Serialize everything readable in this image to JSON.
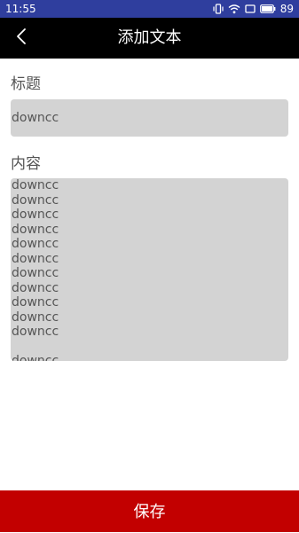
{
  "status_bar": {
    "time": "11:55",
    "battery": "89",
    "icons": [
      "vibrate-icon",
      "wifi-icon",
      "battery-icon"
    ]
  },
  "header": {
    "title": "添加文本",
    "back_icon": "chevron-left-icon"
  },
  "form": {
    "title_label": "标题",
    "title_value": "downcc",
    "content_label": "内容",
    "content_lines": [
      "downcc",
      "downcc",
      "downcc",
      "downcc",
      "downcc",
      "downcc",
      "downcc",
      "downcc",
      "downcc",
      "downcc",
      "downcc",
      "",
      "downcc"
    ]
  },
  "footer": {
    "save_label": "保存"
  },
  "colors": {
    "status_bar": "#2f3e9e",
    "title_bar": "#000000",
    "field_bg": "#d3d3d3",
    "save_bg": "#c20000"
  }
}
